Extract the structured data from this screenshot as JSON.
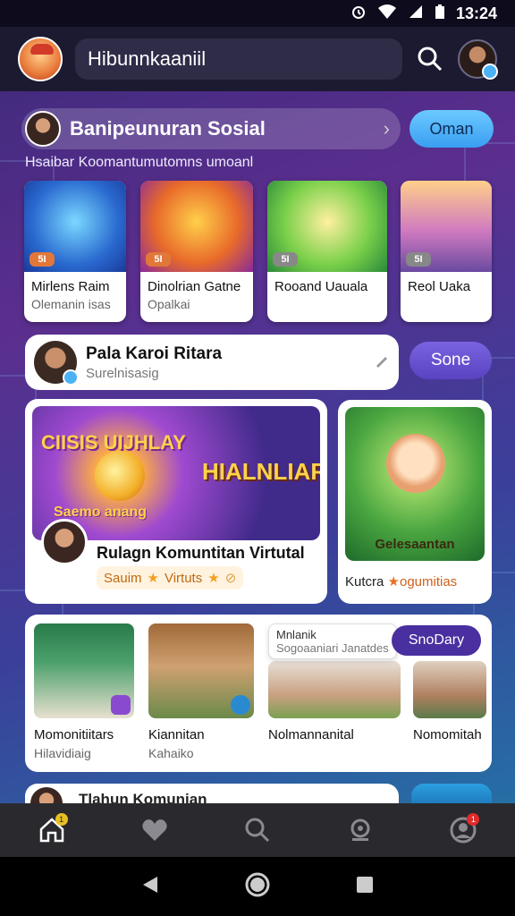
{
  "status_bar": {
    "time": "13:24",
    "icons": [
      "alarm-icon",
      "wifi-icon",
      "signal-icon",
      "battery-icon"
    ]
  },
  "top_bar": {
    "search_text": "Hibunnkaaniil",
    "icons": [
      "mascot-avatar-icon",
      "search-icon",
      "user-avatar-icon"
    ]
  },
  "section": {
    "title": "Banipeunuran Sosial",
    "subtitle": "Hsaibar Koomantumutomns umoanl",
    "join_label": "Oman"
  },
  "game_cards": [
    {
      "title": "Mirlens Raim",
      "sub": "Olemanin isas",
      "badge": "5I"
    },
    {
      "title": "Dinolrian Gatne",
      "sub": "Opalkai",
      "badge": "5I"
    },
    {
      "title": "Rooand Uauala",
      "sub": "",
      "badge": "5I"
    },
    {
      "title": "Reol Uaka",
      "sub": "",
      "badge": "5I"
    }
  ],
  "profile": {
    "name": "Pala Karoi Ritara",
    "sub": "Surelnisasig",
    "button_label": "Sone"
  },
  "feature": {
    "banner_line_1": "CIISIS UIJHLAY",
    "banner_line_2": "HIALNLIAR",
    "banner_line_3": "Saemo anang",
    "title": "Rulagn Komuntitan Virtutal",
    "tag_1": "Sauim",
    "tag_2": "Virtuts",
    "side_caption": "Gelesaantan",
    "side_title": "Kutcra",
    "side_title_2": "ogumitias"
  },
  "community": {
    "popup_line_1": "Mnlanik",
    "popup_line_2": "Sogoaaniari Janatdes",
    "button_label": "SnoDary",
    "items": [
      {
        "title": "Momonitiitars",
        "sub": "Hilavidiaig"
      },
      {
        "title": "Kiannitan",
        "sub": "Kahaiko"
      },
      {
        "title": "Nolmannanital",
        "sub": ""
      },
      {
        "title": "Nomomitah",
        "sub": ""
      }
    ]
  },
  "peek": {
    "title": "Tlahun Komunian"
  },
  "bottom_nav": {
    "items": [
      "home-icon",
      "heart-icon",
      "search-icon",
      "camera-icon",
      "profile-icon"
    ],
    "home_badge": "1",
    "profile_badge": "1"
  },
  "colors": {
    "accent_blue": "#3a9ef2",
    "accent_purple": "#5a43c0",
    "nav_bg": "#2a2a2e"
  }
}
